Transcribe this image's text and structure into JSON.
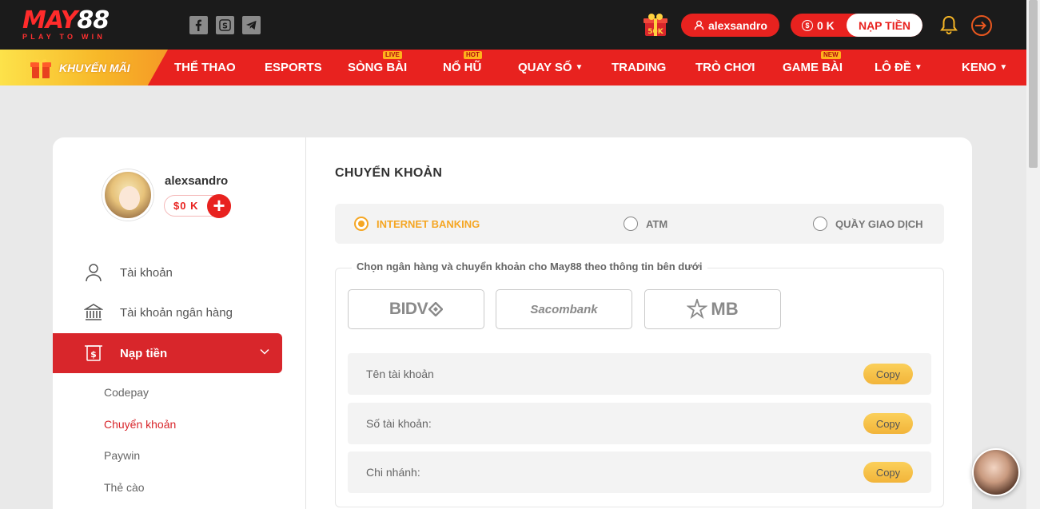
{
  "logo": {
    "brand_red": "MAY",
    "brand_white": "88",
    "tagline": "PLAY TO WIN"
  },
  "header": {
    "social": [
      "facebook-icon",
      "skype-icon",
      "telegram-icon"
    ],
    "gift_badge": "50K",
    "username": "alexsandro",
    "balance": "0 K",
    "deposit_button": "NẠP TIỀN"
  },
  "nav": {
    "promo": "KHUYẾN MÃI",
    "items": [
      {
        "label": "THỂ THAO"
      },
      {
        "label": "ESPORTS"
      },
      {
        "label": "SÒNG BÀI",
        "badge": "LIVE"
      },
      {
        "label": "NỔ HŨ",
        "badge": "HOT"
      },
      {
        "label": "QUAY SỐ"
      },
      {
        "label": "TRADING"
      },
      {
        "label": "TRÒ CHƠI"
      },
      {
        "label": "GAME BÀI",
        "badge": "NEW"
      },
      {
        "label": "LÔ ĐỀ"
      },
      {
        "label": "KENO"
      }
    ]
  },
  "sidebar": {
    "username": "alexsandro",
    "wallet": "$0 K",
    "plus": "+",
    "menu": [
      {
        "label": "Tài khoản"
      },
      {
        "label": "Tài khoản ngân hàng"
      },
      {
        "label": "Nạp tiền"
      }
    ],
    "submenu": [
      {
        "label": "Codepay"
      },
      {
        "label": "Chuyển khoản"
      },
      {
        "label": "Paywin"
      },
      {
        "label": "Thẻ cào"
      }
    ]
  },
  "main": {
    "title": "CHUYỂN KHOẢN",
    "methods": [
      {
        "label": "INTERNET BANKING",
        "selected": true
      },
      {
        "label": "ATM",
        "selected": false
      },
      {
        "label": "QUẦY GIAO DỊCH",
        "selected": false
      }
    ],
    "bank_legend": "Chọn ngân hàng và chuyển khoản cho May88 theo thông tin bên dưới",
    "banks": [
      "BIDV",
      "Sacombank",
      "MB"
    ],
    "fields": [
      {
        "label": "Tên tài khoản",
        "button": "Copy"
      },
      {
        "label": "Số tài khoản:",
        "button": "Copy"
      },
      {
        "label": "Chi nhánh:",
        "button": "Copy"
      }
    ]
  },
  "colors": {
    "primary_red": "#e8221f",
    "accent_gold": "#f5a623",
    "topbar": "#1b1b1b"
  }
}
